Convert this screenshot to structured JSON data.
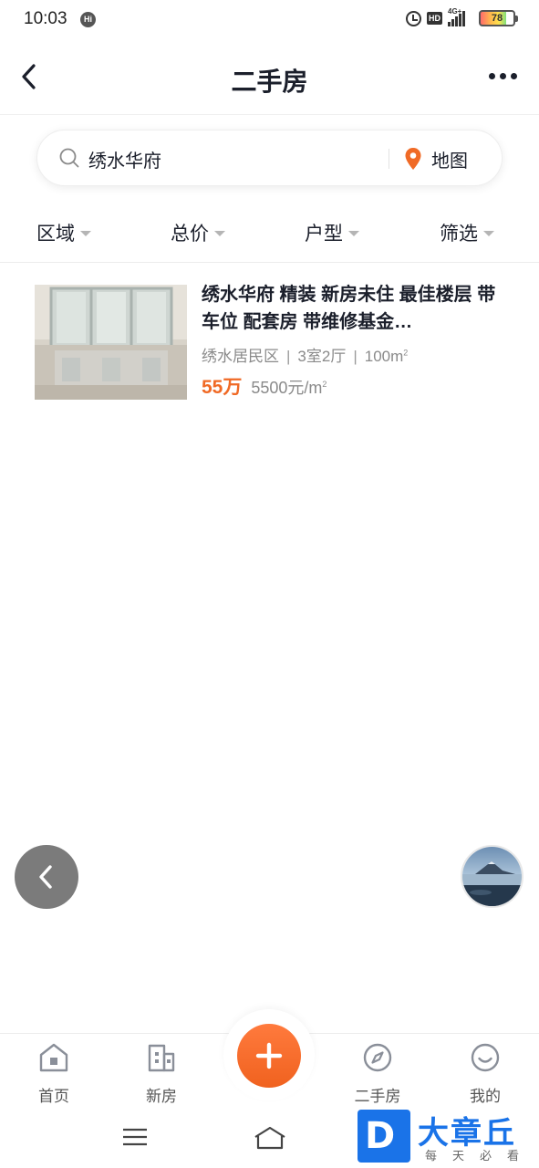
{
  "status_bar": {
    "time": "10:03",
    "hi_badge": "Hi",
    "hd_label": "HD",
    "network": "4G+",
    "battery": "78"
  },
  "header": {
    "title": "二手房"
  },
  "search": {
    "value": "绣水华府",
    "map_label": "地图"
  },
  "filters": [
    {
      "label": "区域"
    },
    {
      "label": "总价"
    },
    {
      "label": "户型"
    },
    {
      "label": "筛选"
    }
  ],
  "listing": {
    "title": "绣水华府 精装 新房未住 最佳楼层 带车位 配套房 带维修基金…",
    "community": "绣水居民区",
    "layout": "3室2厅",
    "area": "100m",
    "price_total": "55万",
    "price_per_sqm": "5500元/m"
  },
  "tabbar": {
    "items": [
      {
        "label": "首页",
        "icon": "home-icon"
      },
      {
        "label": "新房",
        "icon": "building-icon"
      },
      {
        "label": "二手房",
        "icon": "compass-icon"
      },
      {
        "label": "我的",
        "icon": "smile-icon"
      }
    ],
    "center_icon": "plus-icon"
  },
  "watermark": {
    "badge": "D",
    "text": "大章丘",
    "subtitle": "每天必看"
  },
  "colors": {
    "accent": "#f06a26",
    "text": "#1b1f2b",
    "muted": "#8a8a8a",
    "watermark_blue": "#1a73e8"
  }
}
